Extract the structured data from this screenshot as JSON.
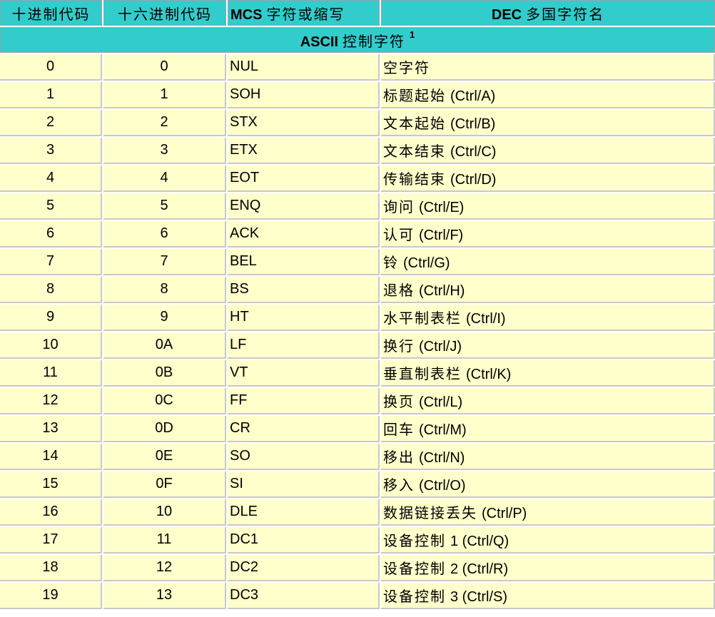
{
  "header": {
    "col_dec": "十进制代码",
    "col_hex": "十六进制代码",
    "col_mcs_bold": "MCS",
    "col_mcs_text": "字符或缩写",
    "col_name_bold": "DEC",
    "col_name_text": "多国字符名"
  },
  "section": {
    "bold": "ASCII",
    "text": "控制字符",
    "footnote": "1"
  },
  "rows": [
    {
      "dec": "0",
      "hex": "0",
      "mcs": "NUL",
      "name": "空字符",
      "key": ""
    },
    {
      "dec": "1",
      "hex": "1",
      "mcs": "SOH",
      "name": "标题起始",
      "key": "(Ctrl/A)"
    },
    {
      "dec": "2",
      "hex": "2",
      "mcs": "STX",
      "name": "文本起始",
      "key": "(Ctrl/B)"
    },
    {
      "dec": "3",
      "hex": "3",
      "mcs": "ETX",
      "name": "文本结束",
      "key": "(Ctrl/C)"
    },
    {
      "dec": "4",
      "hex": "4",
      "mcs": "EOT",
      "name": "传输结束",
      "key": "(Ctrl/D)"
    },
    {
      "dec": "5",
      "hex": "5",
      "mcs": "ENQ",
      "name": "询问",
      "key": "(Ctrl/E)"
    },
    {
      "dec": "6",
      "hex": "6",
      "mcs": "ACK",
      "name": "认可",
      "key": "(Ctrl/F)"
    },
    {
      "dec": "7",
      "hex": "7",
      "mcs": "BEL",
      "name": "铃",
      "key": "(Ctrl/G)"
    },
    {
      "dec": "8",
      "hex": "8",
      "mcs": "BS",
      "name": "退格",
      "key": "(Ctrl/H)"
    },
    {
      "dec": "9",
      "hex": "9",
      "mcs": "HT",
      "name": "水平制表栏",
      "key": "(Ctrl/I)"
    },
    {
      "dec": "10",
      "hex": "0A",
      "mcs": "LF",
      "name": "换行",
      "key": "(Ctrl/J)"
    },
    {
      "dec": "11",
      "hex": "0B",
      "mcs": "VT",
      "name": "垂直制表栏",
      "key": "(Ctrl/K)"
    },
    {
      "dec": "12",
      "hex": "0C",
      "mcs": "FF",
      "name": "换页",
      "key": "(Ctrl/L)"
    },
    {
      "dec": "13",
      "hex": "0D",
      "mcs": "CR",
      "name": "回车",
      "key": "(Ctrl/M)"
    },
    {
      "dec": "14",
      "hex": "0E",
      "mcs": "SO",
      "name": "移出",
      "key": "(Ctrl/N)"
    },
    {
      "dec": "15",
      "hex": "0F",
      "mcs": "SI",
      "name": "移入",
      "key": "(Ctrl/O)"
    },
    {
      "dec": "16",
      "hex": "10",
      "mcs": "DLE",
      "name": "数据链接丢失",
      "key": "(Ctrl/P)"
    },
    {
      "dec": "17",
      "hex": "11",
      "mcs": "DC1",
      "name": "设备控制",
      "key": "1 (Ctrl/Q)"
    },
    {
      "dec": "18",
      "hex": "12",
      "mcs": "DC2",
      "name": "设备控制",
      "key": "2 (Ctrl/R)"
    },
    {
      "dec": "19",
      "hex": "13",
      "mcs": "DC3",
      "name": "设备控制",
      "key": "3 (Ctrl/S)"
    }
  ]
}
